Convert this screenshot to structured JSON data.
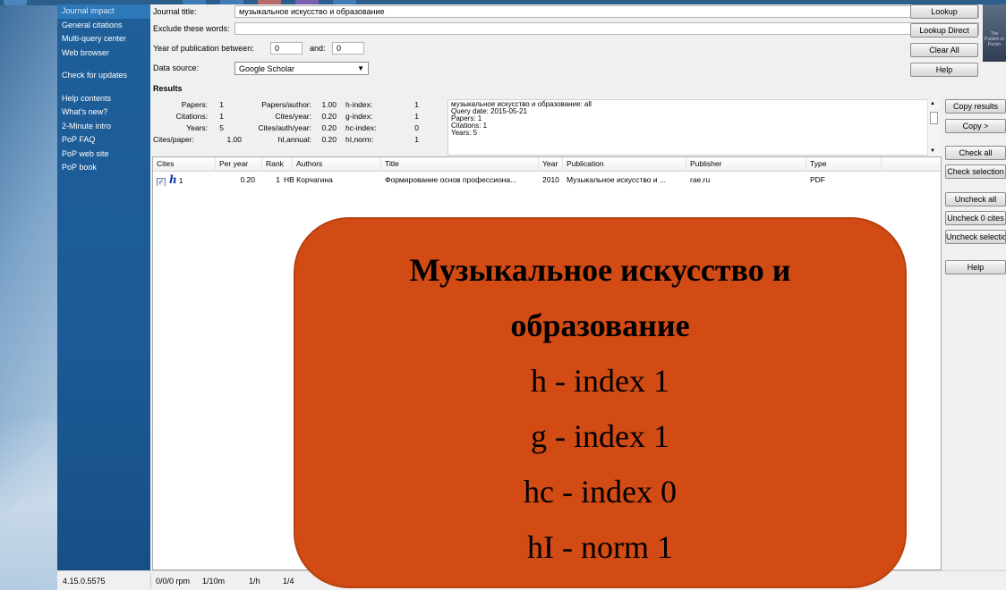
{
  "sidebar": {
    "items": [
      {
        "label": "Journal impact",
        "selected": true
      },
      {
        "label": "General citations"
      },
      {
        "label": "Multi-query center"
      },
      {
        "label": "Web browser"
      },
      {
        "label": "Check for updates"
      },
      {
        "label": "Help contents"
      },
      {
        "label": "What's new?"
      },
      {
        "label": "2-Minute intro"
      },
      {
        "label": "PoP FAQ"
      },
      {
        "label": "PoP web site"
      },
      {
        "label": "PoP book"
      }
    ]
  },
  "form": {
    "journal_title_label": "Journal title:",
    "journal_title_value": "музыкальное искусство и образование",
    "exclude_label": "Exclude these words:",
    "exclude_value": "",
    "year_label": "Year of publication between:",
    "year_from": "0",
    "and_label": "and:",
    "year_to": "0",
    "source_label": "Data source:",
    "source_value": "Google Scholar"
  },
  "buttons": {
    "lookup": "Lookup",
    "lookup_direct": "Lookup Direct",
    "clear_all": "Clear All",
    "help_top": "Help",
    "copy_results": "Copy results",
    "copy": "Copy >",
    "check_all": "Check all",
    "check_selection": "Check selection",
    "uncheck_all": "Uncheck all",
    "uncheck_0": "Uncheck 0 cites",
    "uncheck_selection": "Uncheck selection",
    "help_side": "Help"
  },
  "results": {
    "title": "Results",
    "stats": {
      "papers_label": "Papers:",
      "papers": "1",
      "citations_label": "Citations:",
      "citations": "1",
      "years_label": "Years:",
      "years": "5",
      "cites_paper_label": "Cites/paper:",
      "cites_paper": "1.00",
      "papers_author_label": "Papers/author:",
      "papers_author": "1.00",
      "cites_year_label": "Cites/year:",
      "cites_year": "0.20",
      "cites_auth_year_label": "Cites/auth/year:",
      "cites_auth_year": "0.20",
      "hi_annual_label": "hI,annual:",
      "hi_annual": "0.20",
      "h_index_label": "h-index:",
      "h_index": "1",
      "g_index_label": "g-index:",
      "g_index": "1",
      "hc_index_label": "hc-index:",
      "hc_index": "0",
      "hi_norm_label": "hI,norm:",
      "hi_norm": "1"
    },
    "summary_lines": [
      "музыкальное искусство и образование: all",
      "Query date: 2015-05-21",
      "Papers: 1",
      "Citations: 1",
      "Years: 5"
    ]
  },
  "table": {
    "headers": [
      "Cites",
      "Per year",
      "Rank",
      "Authors",
      "Title",
      "Year",
      "Publication",
      "Publisher",
      "Type"
    ],
    "rows": [
      {
        "cites": "1",
        "per_year": "0.20",
        "rank": "1",
        "authors": "НВ Корчагина",
        "title": "Формирование основ профессиона...",
        "year": "2010",
        "publication": "Музыкальное искусство и ...",
        "publisher": "rae.ru",
        "type": "PDF"
      }
    ]
  },
  "statusbar": {
    "version": "4.15.0.5575",
    "rpm": "0/0/0 rpm",
    "per10m": "1/10m",
    "perh": "1/h",
    "per4": "1/4"
  },
  "overlay": {
    "title_line1": "Музыкальное искусство и",
    "title_line2": "образование",
    "lines": [
      "h - index 1",
      "g - index 1",
      "hc - index 0",
      "hI - norm 1"
    ]
  },
  "thumbnail": {
    "text": "The Publish or Perish"
  },
  "colors": {
    "sidebar": "#1b5a96",
    "overlay": "#d24a14",
    "h_logo": "#1339b0"
  }
}
